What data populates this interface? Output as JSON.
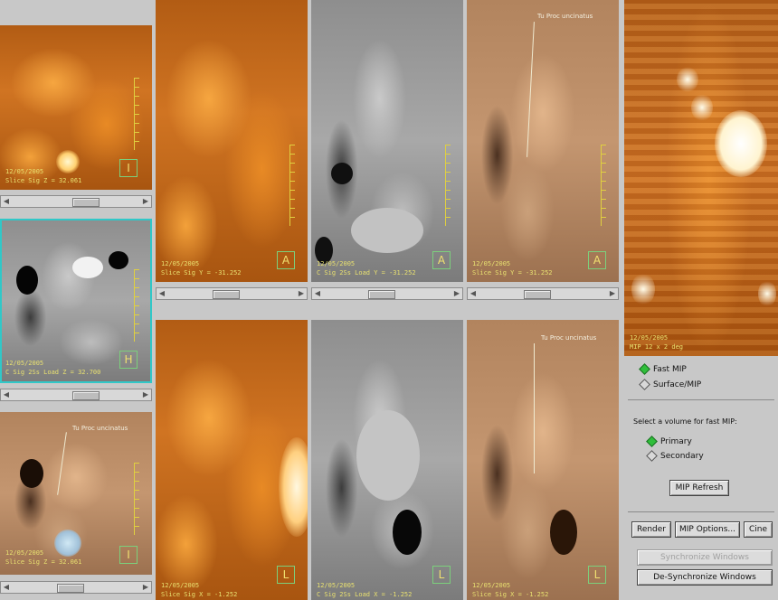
{
  "viewports": {
    "left_top": {
      "date": "12/05/2005",
      "slice": "Slice Sig Z = 32.061",
      "orient": "I"
    },
    "left_mid": {
      "date": "12/05/2005",
      "slice": "C Sig 2Ss Load Z = 32.700",
      "orient": "H"
    },
    "left_bot": {
      "date": "12/05/2005",
      "slice": "Slice Sig Z = 32.061",
      "orient": "I",
      "annotation": "Tu Proc uncinatus"
    },
    "top_pet": {
      "date": "12/05/2005",
      "slice": "Slice Sig Y = -31.252",
      "orient": "A"
    },
    "top_ct": {
      "date": "12/05/2005",
      "slice": "C Sig 2Ss Load Y = -31.252",
      "orient": "A"
    },
    "top_fuse": {
      "date": "12/05/2005",
      "slice": "Slice Sig Y = -31.252",
      "orient": "A",
      "annotation": "Tu Proc uncinatus"
    },
    "bot_pet": {
      "date": "12/05/2005",
      "slice": "Slice Sig X = -1.252",
      "orient": "L"
    },
    "bot_ct": {
      "date": "12/05/2005",
      "slice": "C Sig 2Ss Load X = -1.252",
      "orient": "L"
    },
    "bot_fuse": {
      "date": "12/05/2005",
      "slice": "Slice Sig X = -1.252",
      "orient": "L",
      "annotation": "Tu Proc uncinatus"
    },
    "mip": {
      "date": "12/05/2005",
      "slice": "MIP 12 x 2 deg"
    }
  },
  "panel": {
    "fast_mip": "Fast MIP",
    "surface_mip": "Surface/MIP",
    "select_prompt": "Select a volume for fast MIP:",
    "primary": "Primary",
    "secondary": "Secondary",
    "mip_refresh": "MIP Refresh",
    "render": "Render",
    "mip_options": "MIP Options...",
    "cine": "Cine",
    "sync": "Synchronize Windows",
    "desync": "De-Synchronize Windows"
  },
  "colors": {
    "active_border": "#30c8c8",
    "overlay_text": "#e8e070",
    "radio_on": "#2fbe3a"
  },
  "scrollbars": {
    "left_top": 0.6,
    "left_mid": 0.6,
    "left_bot": 0.45,
    "top_pet": 0.45,
    "top_ct": 0.45,
    "top_fuse": 0.45
  }
}
